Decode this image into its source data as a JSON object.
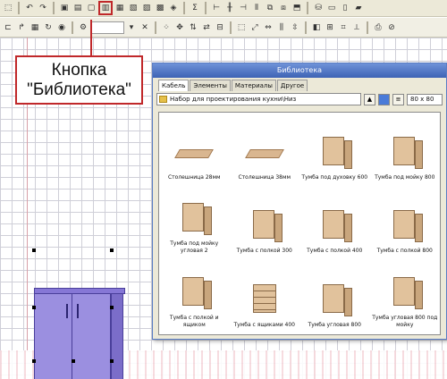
{
  "callout": {
    "line1": "Кнопка",
    "line2": "\"Библиотека\""
  },
  "toolbar2": {
    "zoom_value": ""
  },
  "library": {
    "title": "Библиотека",
    "tabs": [
      "Кабель",
      "Элементы",
      "Материалы",
      "Другое"
    ],
    "active_tab": 0,
    "path": "Набор для проектирования кухни\\Низ",
    "size_value": "80 x 80",
    "items": [
      {
        "label": "Столешница 28мм",
        "shape": "slab"
      },
      {
        "label": "Столешница 38мм",
        "shape": "slab"
      },
      {
        "label": "Тумба под духовку 600",
        "shape": "box"
      },
      {
        "label": "Тумба под мойку 800",
        "shape": "box"
      },
      {
        "label": "Тумба под мойку угловая 2",
        "shape": "box"
      },
      {
        "label": "Тумба с полкой 300",
        "shape": "box"
      },
      {
        "label": "Тумба с полкой 400",
        "shape": "box"
      },
      {
        "label": "Тумба с полкой 800",
        "shape": "box"
      },
      {
        "label": "Тумба с полкой и ящиком",
        "shape": "box"
      },
      {
        "label": "Тумба с ящиками 400",
        "shape": "drawers"
      },
      {
        "label": "Тумба угловая 800",
        "shape": "box"
      },
      {
        "label": "Тумба угловая 800 под мойку",
        "shape": "box"
      }
    ]
  },
  "colors": {
    "highlight": "#c0282a",
    "cabinet": "#9b8fe0",
    "title_bar": "#3d63b5"
  }
}
